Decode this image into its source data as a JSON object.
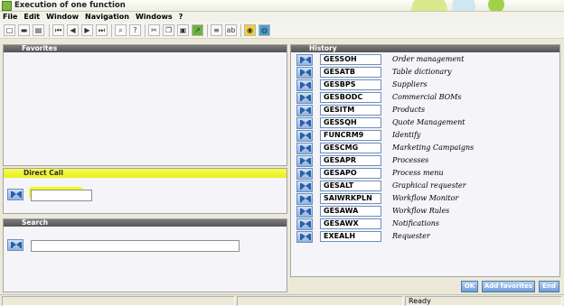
{
  "window": {
    "title": "Execution of one function"
  },
  "menu": [
    "File",
    "Edit",
    "Window",
    "Navigation",
    "Windows",
    "?"
  ],
  "toolbar_icons": [
    "new-icon",
    "print-icon",
    "save-icon",
    "first-icon",
    "previous-icon",
    "next-icon",
    "last-icon",
    "attach-icon",
    "help-icon",
    "copy-icon",
    "duplicate-icon",
    "paste-icon",
    "export-icon",
    "list-icon",
    "text-icon",
    "settings-icon",
    "globe-icon"
  ],
  "favorites": {
    "title": "Favorites"
  },
  "direct_call": {
    "title": "Direct Call",
    "value": ""
  },
  "search": {
    "title": "Search",
    "value": ""
  },
  "history": {
    "title": "History",
    "items": [
      {
        "code": "GESSOH",
        "desc": "Order management"
      },
      {
        "code": "GESATB",
        "desc": "Table dictionary"
      },
      {
        "code": "GESBPS",
        "desc": "Suppliers"
      },
      {
        "code": "GESBODC",
        "desc": "Commercial BOMs"
      },
      {
        "code": "GESITM",
        "desc": "Products"
      },
      {
        "code": "GESSQH",
        "desc": "Quote Management"
      },
      {
        "code": "FUNCRM9",
        "desc": "Identify"
      },
      {
        "code": "GESCMG",
        "desc": "Marketing Campaigns"
      },
      {
        "code": "GESAPR",
        "desc": "Processes"
      },
      {
        "code": "GESAPO",
        "desc": "Process menu"
      },
      {
        "code": "GESALT",
        "desc": "Graphical requester"
      },
      {
        "code": "SAIWRKPLN",
        "desc": "Workflow Monitor"
      },
      {
        "code": "GESAWA",
        "desc": "Workflow Rules"
      },
      {
        "code": "GESAWX",
        "desc": "Notifications"
      },
      {
        "code": "EXEALH",
        "desc": "Requester"
      }
    ]
  },
  "buttons": {
    "ok": "OK",
    "add_favorites": "Add favorites",
    "end": "End"
  },
  "status": {
    "text": "Ready"
  },
  "colors": {
    "highlight": "#f4fa1e",
    "button_blue": "#6e9ed6",
    "panel_header": "#555555"
  }
}
